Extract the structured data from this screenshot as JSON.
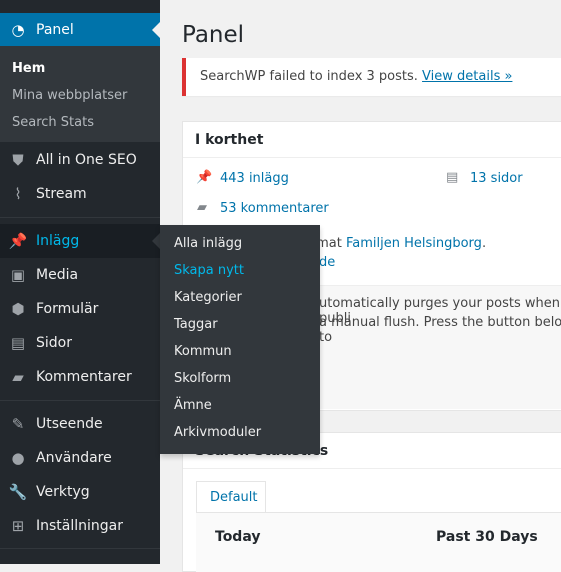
{
  "sidebar": {
    "panel": "Panel",
    "submenu": [
      "Hem",
      "Mina webbplatser",
      "Search Stats"
    ],
    "items": [
      "All in One SEO",
      "Stream",
      "Inlägg",
      "Media",
      "Formulär",
      "Sidor",
      "Kommentarer",
      "Utseende",
      "Användare",
      "Verktyg",
      "Inställningar"
    ]
  },
  "flyout": [
    "Alla inlägg",
    "Skapa nytt",
    "Kategorier",
    "Taggar",
    "Kommun",
    "Skolform",
    "Ämne",
    "Arkivmoduler"
  ],
  "main": {
    "title": "Panel",
    "notice": {
      "text": "SearchWP failed to index 3 posts. ",
      "link": "View details »"
    },
    "glance": {
      "title": "I korthet",
      "posts": "443 inlägg",
      "pages": "13 sidor",
      "comments": "53 kommentarer",
      "theme_prefix": "temat ",
      "theme_link": "Familjen Helsingborg",
      "theme_suffix": ".",
      "partial_link": "de"
    },
    "purge": {
      "line1": "utomatically purges your posts when publi",
      "line2": "a manual flush. Press the button below to"
    },
    "stats": {
      "title": "Search Statistics",
      "tab": "Default",
      "today": "Today",
      "past30": "Past 30 Days"
    }
  },
  "colors": {
    "accent": "#0073aa",
    "sidebar": "#23282d",
    "hover": "#00b9eb",
    "error": "#dc3232"
  }
}
